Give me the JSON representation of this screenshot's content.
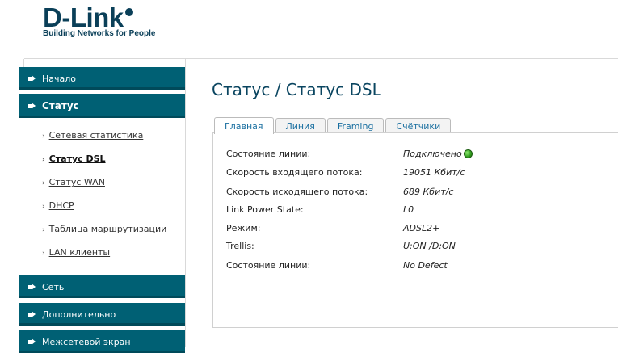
{
  "brand": {
    "name": "D-Link",
    "tagline": "Building Networks for People"
  },
  "sidebar": {
    "items": [
      {
        "label": "Начало"
      },
      {
        "label": "Статус"
      },
      {
        "label": "Сеть"
      },
      {
        "label": "Дополнительно"
      },
      {
        "label": "Межсетевой экран"
      }
    ],
    "status_sub_items": [
      {
        "label": "Сетевая статистика"
      },
      {
        "label": "Статус DSL"
      },
      {
        "label": "Статус WAN"
      },
      {
        "label": "DHCP"
      },
      {
        "label": "Таблица маршрутизации"
      },
      {
        "label": "LAN клиенты"
      }
    ],
    "bullet": "›"
  },
  "main": {
    "title": "Статус / Статус DSL",
    "tabs": [
      {
        "label": "Главная"
      },
      {
        "label": "Линия"
      },
      {
        "label": "Framing"
      },
      {
        "label": "Счётчики"
      }
    ],
    "rows": [
      {
        "label": "Состояние линии:",
        "value": "Подключено"
      },
      {
        "label": "Скорость входящего потока:",
        "value": "19051 Кбит/с"
      },
      {
        "label": "Скорость исходящего потока:",
        "value": "689 Кбит/с"
      },
      {
        "label": "Link Power State:",
        "value": "L0"
      },
      {
        "label": "Режим:",
        "value": "ADSL2+"
      },
      {
        "label": "Trellis:",
        "value": "U:ON /D:ON"
      },
      {
        "label": "Состояние линии:",
        "value": "No Defect"
      }
    ]
  },
  "colors": {
    "nav_bar": "#006074",
    "title": "#0a4560",
    "tab_text": "#1a6fa0",
    "status_ok": "#2f9a1c"
  },
  "icons": {
    "nav_arrow": "arrow-right-icon",
    "connected": "status-dot-icon"
  }
}
